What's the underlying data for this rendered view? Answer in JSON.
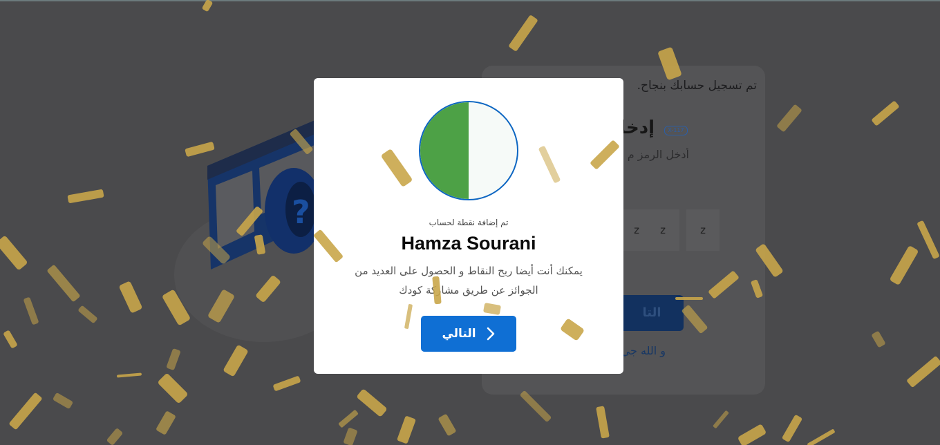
{
  "background_page": {
    "success_text": "تم تسجيل حسابك بنجاح.",
    "heading": "إدخا",
    "badge": "X-117",
    "subtitle": "أدخل الرمز م",
    "code_chars": [
      "z",
      "z",
      "z"
    ],
    "button_label": "التا",
    "link_text": "و الله جي"
  },
  "modal": {
    "points_added": "تم إضافة نقطة لحساب",
    "user_name": "Hamza Sourani",
    "description": "يمكنك أنت أيضا ربح النقاط و الحصول على العديد من الجوائز عن طريق مشاركة كودك",
    "next_button": "التالي",
    "next_icon": "chevron-right-icon",
    "avatar_colors": {
      "left": "#4da146",
      "right": "#f6faf8",
      "border": "#0d66c2"
    }
  },
  "colors": {
    "overlay": "#4a4a4c",
    "primary_button": "#0f6fd4",
    "confetti": "#c9a64a"
  }
}
